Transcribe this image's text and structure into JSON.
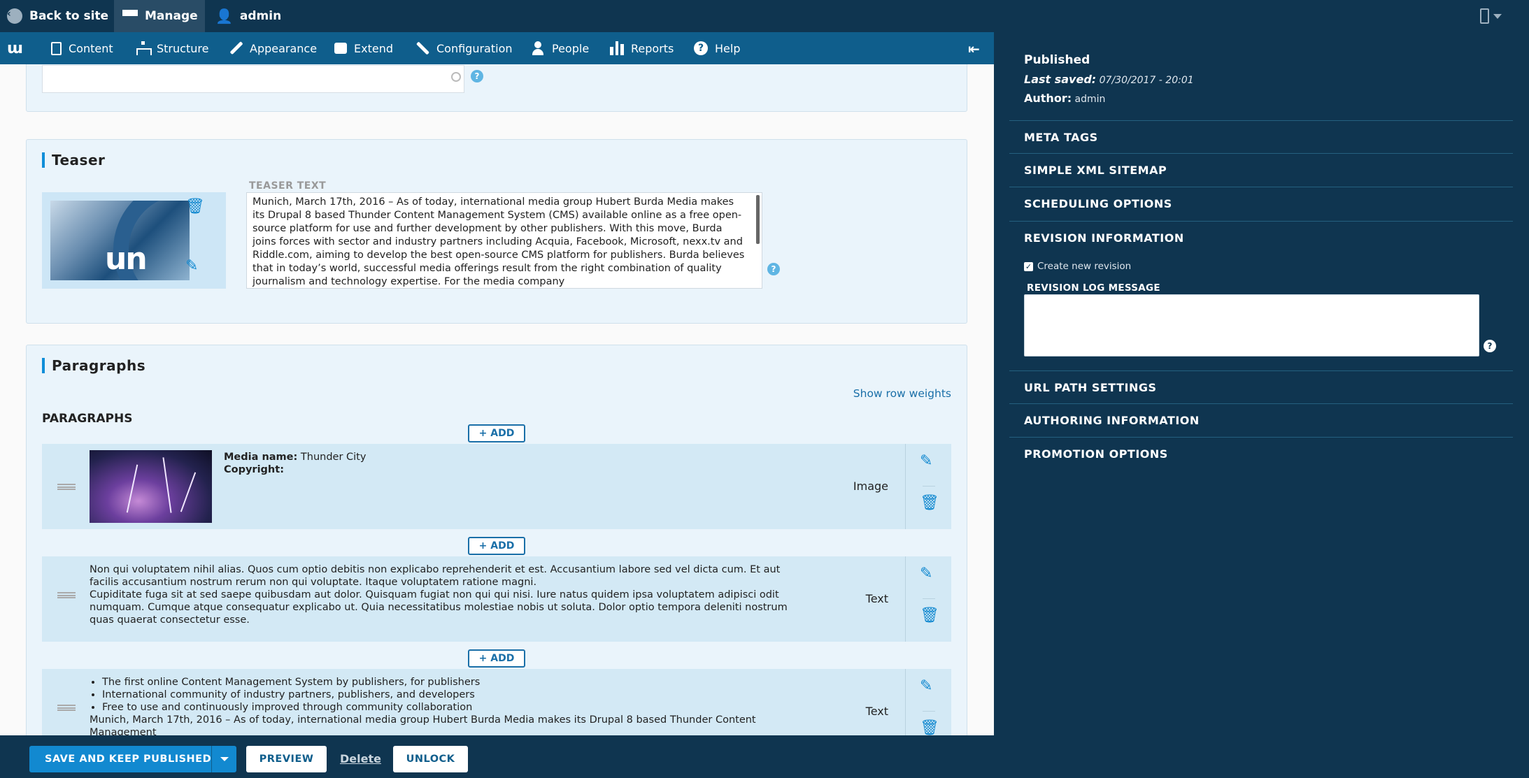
{
  "toolbar": {
    "back_label": "Back to site",
    "manage_label": "Manage",
    "user_label": "admin"
  },
  "tray": {
    "items": [
      "Content",
      "Structure",
      "Appearance",
      "Extend",
      "Configuration",
      "People",
      "Reports",
      "Help"
    ]
  },
  "teaser": {
    "title": "Teaser",
    "text_label": "TEASER TEXT",
    "text": "Munich, March 17th, 2016 – As of today, international media group Hubert Burda Media makes its Drupal 8 based Thunder Content Management System (CMS) available online as a free open-source platform for use and further development by other publishers. With this move, Burda joins forces with sector and industry partners including Acquia, Facebook, Microsoft, nexx.tv and Riddle.com, aiming to develop the best open-source CMS platform for publishers. Burda believes that in today’s world, successful media offerings result from the right combination of quality journalism and technology expertise. For the media company"
  },
  "paragraphs": {
    "title": "Paragraphs",
    "show_row_weights": "Show row weights",
    "label": "PARAGRAPHS",
    "add_label": "+ ADD",
    "rows": [
      {
        "type": "Image",
        "media_name_label": "Media name:",
        "media_name": "Thunder City",
        "copyright_label": "Copyright:"
      },
      {
        "type": "Text",
        "line1": "Non qui voluptatem nihil alias. Quos cum optio debitis non explicabo reprehenderit et est. Accusantium labore sed vel dicta cum. Et aut facilis accusantium nostrum rerum non qui voluptate. Itaque voluptatem ratione magni.",
        "line2": "Cupiditate fuga sit at sed saepe quibusdam aut dolor. Quisquam fugiat non qui qui nisi. Iure natus quidem ipsa voluptatem adipisci odit numquam. Cumque atque consequatur explicabo ut. Quia necessitatibus molestiae nobis ut soluta. Dolor optio tempora deleniti nostrum quas quaerat consectetur esse."
      },
      {
        "type": "Text",
        "bullets": [
          "The first online Content Management System by publishers, for publishers",
          "International community of industry partners, publishers, and developers",
          "Free to use and continuously improved through community collaboration"
        ],
        "tail": "Munich, March 17th, 2016 – As of today, international media group Hubert Burda Media makes its Drupal 8 based Thunder Content Management"
      }
    ]
  },
  "footer": {
    "save_label": "SAVE AND KEEP PUBLISHED",
    "preview_label": "PREVIEW",
    "delete_label": "Delete",
    "unlock_label": "UNLOCK"
  },
  "sidebar": {
    "status": "Published",
    "last_saved_label": "Last saved:",
    "last_saved_value": "07/30/2017 - 20:01",
    "author_label": "Author:",
    "author_value": "admin",
    "sections": {
      "meta_tags": "META TAGS",
      "xml_sitemap": "SIMPLE XML SITEMAP",
      "scheduling": "SCHEDULING OPTIONS",
      "revision": "REVISION INFORMATION",
      "url_path": "URL PATH SETTINGS",
      "authoring": "AUTHORING INFORMATION",
      "promotion": "PROMOTION OPTIONS"
    },
    "create_revision_label": "Create new revision",
    "create_revision_checked": true,
    "revision_log_label": "REVISION LOG MESSAGE"
  },
  "colors": {
    "toolbar_dark": "#0f3550",
    "tray_blue": "#0f5e8c",
    "accent": "#1289d0",
    "panel_bg": "#eaf4fb"
  }
}
